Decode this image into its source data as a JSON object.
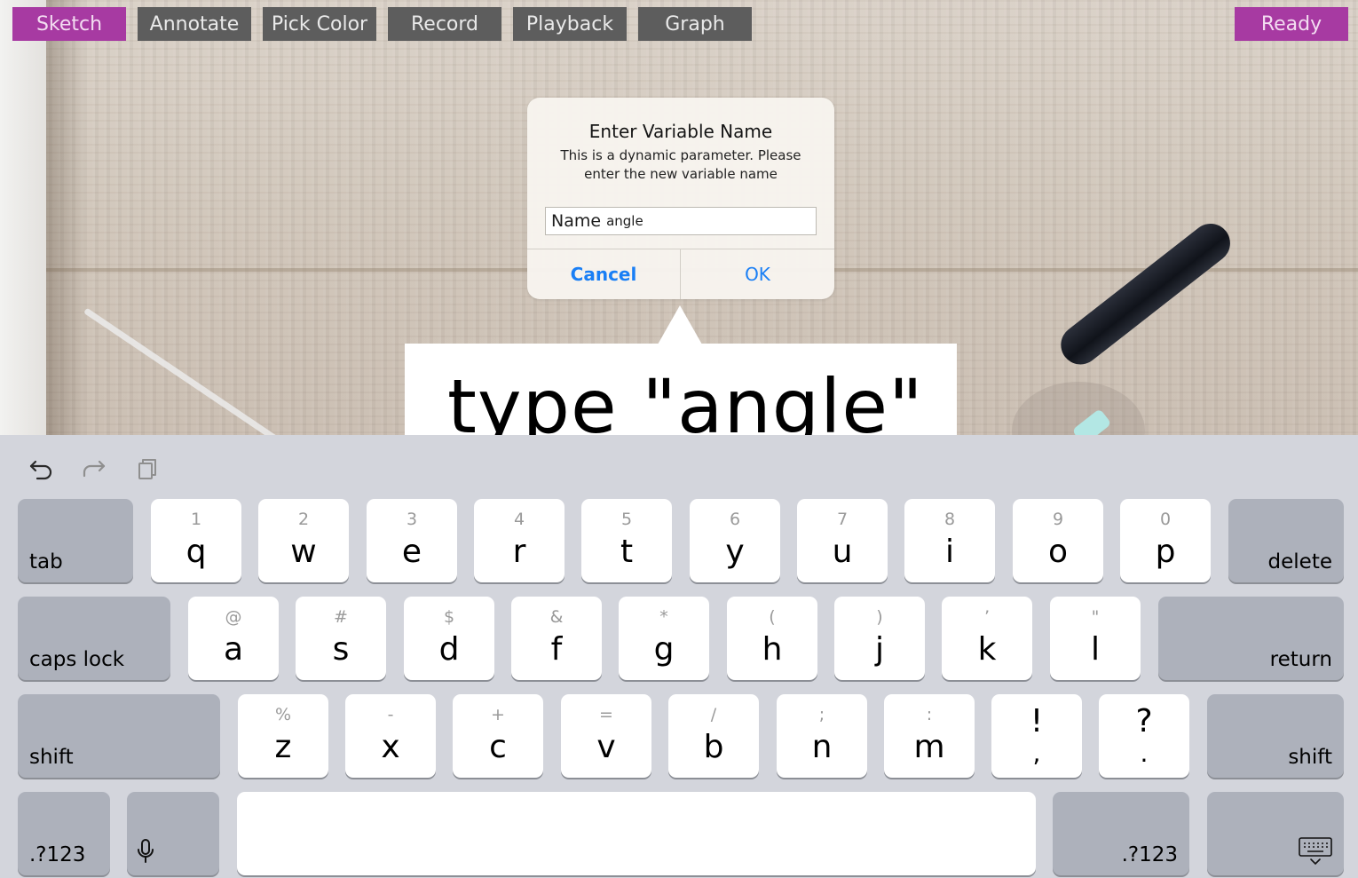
{
  "toolbar": {
    "sketch": "Sketch",
    "annotate": "Annotate",
    "pick_color": "Pick Color",
    "record": "Record",
    "playback": "Playback",
    "graph": "Graph",
    "ready": "Ready",
    "active_color": "#a73aa2",
    "button_color": "#5d5d5d"
  },
  "dialog": {
    "title": "Enter Variable Name",
    "message_line1": "This is a dynamic parameter. Please",
    "message_line2": "enter the new variable name",
    "field_label": "Name",
    "field_value": "angle",
    "cancel": "Cancel",
    "ok": "OK",
    "button_color": "#1a7ff5"
  },
  "callout": {
    "text": "type \"angle\""
  },
  "keyboard": {
    "assistant": [
      "undo-icon",
      "redo-icon",
      "paste-icon"
    ],
    "row1": [
      {
        "sub": "1",
        "main": "q"
      },
      {
        "sub": "2",
        "main": "w"
      },
      {
        "sub": "3",
        "main": "e"
      },
      {
        "sub": "4",
        "main": "r"
      },
      {
        "sub": "5",
        "main": "t"
      },
      {
        "sub": "6",
        "main": "y"
      },
      {
        "sub": "7",
        "main": "u"
      },
      {
        "sub": "8",
        "main": "i"
      },
      {
        "sub": "9",
        "main": "o"
      },
      {
        "sub": "0",
        "main": "p"
      }
    ],
    "row2": [
      {
        "sub": "@",
        "main": "a"
      },
      {
        "sub": "#",
        "main": "s"
      },
      {
        "sub": "$",
        "main": "d"
      },
      {
        "sub": "&",
        "main": "f"
      },
      {
        "sub": "*",
        "main": "g"
      },
      {
        "sub": "(",
        "main": "h"
      },
      {
        "sub": ")",
        "main": "j"
      },
      {
        "sub": "’",
        "main": "k"
      },
      {
        "sub": "\"",
        "main": "l"
      }
    ],
    "row3": [
      {
        "sub": "%",
        "main": "z"
      },
      {
        "sub": "-",
        "main": "x"
      },
      {
        "sub": "+",
        "main": "c"
      },
      {
        "sub": "=",
        "main": "v"
      },
      {
        "sub": "/",
        "main": "b"
      },
      {
        "sub": ";",
        "main": "n"
      },
      {
        "sub": ":",
        "main": "m"
      }
    ],
    "punct": [
      {
        "top": "!",
        "bottom": ","
      },
      {
        "top": "?",
        "bottom": "."
      }
    ],
    "tab": "tab",
    "delete": "delete",
    "caps_lock": "caps lock",
    "return": "return",
    "shift_left": "shift",
    "shift_right": "shift",
    "numbers_left": ".?123",
    "numbers_right": ".?123",
    "mic": "microphone-icon",
    "dismiss": "keyboard-dismiss-icon"
  }
}
